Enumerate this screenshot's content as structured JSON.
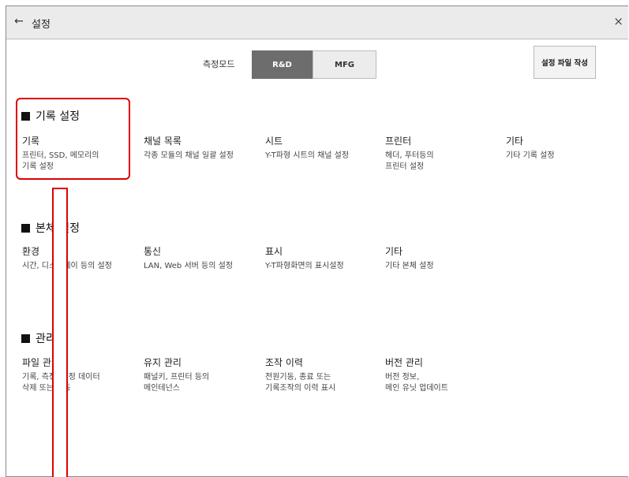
{
  "titlebar": {
    "back_icon": "←",
    "title": "설정",
    "close_icon": "×"
  },
  "mode": {
    "label": "측정모드",
    "options": [
      "R&D",
      "MFG"
    ],
    "selected": "R&D"
  },
  "config_button": "설정 파일 작성",
  "sections": [
    {
      "heading": "기록 설정",
      "items": [
        {
          "title": "기록",
          "desc": "프린터, SSD, 메모리의\n기록 설정"
        },
        {
          "title": "채널 목록",
          "desc": "각종 모듈의 채널 일괄 설정"
        },
        {
          "title": "시트",
          "desc": "Y-T파형 시트의 채널 설정"
        },
        {
          "title": "프린터",
          "desc": "헤더, 푸터등의\n프린터 설정"
        },
        {
          "title": "기타",
          "desc": "기타 기록 설정"
        }
      ]
    },
    {
      "heading": "본체 설정",
      "items": [
        {
          "title": "환경",
          "desc": "시간, 디스플레이 등의 설정"
        },
        {
          "title": "통신",
          "desc": "LAN, Web 서버 등의 설정"
        },
        {
          "title": "표시",
          "desc": "Y-T파형화면의 표시설정"
        },
        {
          "title": "기타",
          "desc": "기타 본체 설정"
        }
      ]
    },
    {
      "heading": "관리",
      "items": [
        {
          "title": "파일 관리",
          "desc": "기록, 측정, 설정 데이터\n삭제 또는 이동"
        },
        {
          "title": "유지 관리",
          "desc": "패널키, 프린터 등의\n메인테넌스"
        },
        {
          "title": "조작 이력",
          "desc": "전원기동, 종료 또는\n기록조작의 이력 표시"
        },
        {
          "title": "버전 관리",
          "desc": "버전 정보,\n메인 유닛 업데이트"
        }
      ]
    }
  ],
  "colors": {
    "highlight": "#e00000",
    "selected_mode_bg": "#6d6d6d"
  }
}
